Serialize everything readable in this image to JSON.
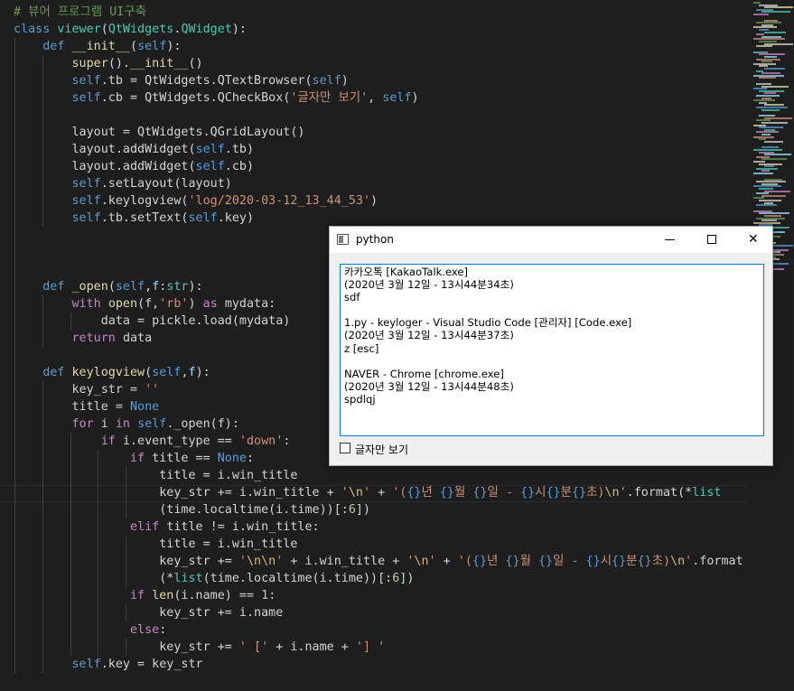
{
  "editor": {
    "lines": [
      [
        {
          "t": "# 뷰어 프로그램 UI구축",
          "c": "cmt"
        }
      ],
      [
        {
          "t": "class ",
          "c": "kw"
        },
        {
          "t": "viewer",
          "c": "cls"
        },
        {
          "t": "("
        },
        {
          "t": "QtWidgets",
          "c": "cls"
        },
        {
          "t": "."
        },
        {
          "t": "QWidget",
          "c": "cls"
        },
        {
          "t": "):"
        }
      ],
      [
        {
          "t": "    "
        },
        {
          "t": "def ",
          "c": "kw"
        },
        {
          "t": "__init__",
          "c": "fn"
        },
        {
          "t": "("
        },
        {
          "t": "self",
          "c": "self"
        },
        {
          "t": "):"
        }
      ],
      [
        {
          "t": "        "
        },
        {
          "t": "super",
          "c": "fn"
        },
        {
          "t": "()."
        },
        {
          "t": "__init__",
          "c": "fn"
        },
        {
          "t": "()"
        }
      ],
      [
        {
          "t": "        "
        },
        {
          "t": "self",
          "c": "self"
        },
        {
          "t": ".tb = QtWidgets.QTextBrowser("
        },
        {
          "t": "self",
          "c": "self"
        },
        {
          "t": ")"
        }
      ],
      [
        {
          "t": "        "
        },
        {
          "t": "self",
          "c": "self"
        },
        {
          "t": ".cb = QtWidgets.QCheckBox("
        },
        {
          "t": "'글자만 보기'",
          "c": "str"
        },
        {
          "t": ", "
        },
        {
          "t": "self",
          "c": "self"
        },
        {
          "t": ")"
        }
      ],
      [],
      [
        {
          "t": "        layout = QtWidgets.QGridLayout()"
        }
      ],
      [
        {
          "t": "        layout.addWidget("
        },
        {
          "t": "self",
          "c": "self"
        },
        {
          "t": ".tb)"
        }
      ],
      [
        {
          "t": "        layout.addWidget("
        },
        {
          "t": "self",
          "c": "self"
        },
        {
          "t": ".cb)"
        }
      ],
      [
        {
          "t": "        "
        },
        {
          "t": "self",
          "c": "self"
        },
        {
          "t": ".setLayout(layout)"
        }
      ],
      [
        {
          "t": "        "
        },
        {
          "t": "self",
          "c": "self"
        },
        {
          "t": ".keylogview("
        },
        {
          "t": "'log/2020-03-12_13_44_53'",
          "c": "str"
        },
        {
          "t": ")"
        }
      ],
      [
        {
          "t": "        "
        },
        {
          "t": "self",
          "c": "self"
        },
        {
          "t": ".tb.setText("
        },
        {
          "t": "self",
          "c": "self"
        },
        {
          "t": ".key)"
        }
      ],
      [],
      [],
      [],
      [
        {
          "t": "    "
        },
        {
          "t": "def ",
          "c": "kw"
        },
        {
          "t": "_open",
          "c": "fn"
        },
        {
          "t": "("
        },
        {
          "t": "self",
          "c": "self"
        },
        {
          "t": ","
        },
        {
          "t": "f",
          "c": "param"
        },
        {
          "t": ":"
        },
        {
          "t": "str",
          "c": "cls"
        },
        {
          "t": "):"
        }
      ],
      [
        {
          "t": "        "
        },
        {
          "t": "with ",
          "c": "ctl"
        },
        {
          "t": "open",
          "c": "fn"
        },
        {
          "t": "(f,"
        },
        {
          "t": "'rb'",
          "c": "str"
        },
        {
          "t": ") "
        },
        {
          "t": "as ",
          "c": "ctl"
        },
        {
          "t": "mydata:"
        }
      ],
      [
        {
          "t": "            data = pickle.load(mydata)"
        }
      ],
      [
        {
          "t": "        "
        },
        {
          "t": "return ",
          "c": "ctl"
        },
        {
          "t": "data"
        }
      ],
      [],
      [
        {
          "t": "    "
        },
        {
          "t": "def ",
          "c": "kw"
        },
        {
          "t": "keylogview",
          "c": "fn"
        },
        {
          "t": "("
        },
        {
          "t": "self",
          "c": "self"
        },
        {
          "t": ","
        },
        {
          "t": "f",
          "c": "param"
        },
        {
          "t": "):"
        }
      ],
      [
        {
          "t": "        key_str = "
        },
        {
          "t": "''",
          "c": "str"
        }
      ],
      [
        {
          "t": "        title = "
        },
        {
          "t": "None",
          "c": "kw"
        }
      ],
      [
        {
          "t": "        "
        },
        {
          "t": "for ",
          "c": "ctl"
        },
        {
          "t": "i "
        },
        {
          "t": "in ",
          "c": "ctl"
        },
        {
          "t": "self",
          "c": "self"
        },
        {
          "t": "._open(f):"
        }
      ],
      [
        {
          "t": "            "
        },
        {
          "t": "if ",
          "c": "ctl"
        },
        {
          "t": "i.event_type == "
        },
        {
          "t": "'down'",
          "c": "str"
        },
        {
          "t": ":"
        }
      ],
      [
        {
          "t": "                "
        },
        {
          "t": "if ",
          "c": "ctl"
        },
        {
          "t": "title == "
        },
        {
          "t": "None",
          "c": "kw"
        },
        {
          "t": ":"
        }
      ],
      [
        {
          "t": "                    title = i.win_title"
        }
      ],
      [
        {
          "t": "                    key_str += i.win_title + "
        },
        {
          "t": "'",
          "c": "str"
        },
        {
          "t": "\\n",
          "c": "esc"
        },
        {
          "t": "'",
          "c": "str"
        },
        {
          "t": " + "
        },
        {
          "t": "'(",
          "c": "str"
        },
        {
          "t": "{}",
          "c": "kw"
        },
        {
          "t": "년 ",
          "c": "str"
        },
        {
          "t": "{}",
          "c": "kw"
        },
        {
          "t": "월 ",
          "c": "str"
        },
        {
          "t": "{}",
          "c": "kw"
        },
        {
          "t": "일 - ",
          "c": "str"
        },
        {
          "t": "{}",
          "c": "kw"
        },
        {
          "t": "시",
          "c": "str"
        },
        {
          "t": "{}",
          "c": "kw"
        },
        {
          "t": "분",
          "c": "str"
        },
        {
          "t": "{}",
          "c": "kw"
        },
        {
          "t": "초)",
          "c": "str"
        },
        {
          "t": "\\n",
          "c": "esc"
        },
        {
          "t": "'",
          "c": "str"
        },
        {
          "t": ".format(*"
        },
        {
          "t": "list",
          "c": "cls"
        }
      ],
      [
        {
          "t": "                    (time.localtime(i.time))[:"
        },
        {
          "t": "6",
          "c": "num"
        },
        {
          "t": "])"
        }
      ],
      [
        {
          "t": "                "
        },
        {
          "t": "elif ",
          "c": "ctl"
        },
        {
          "t": "title != i.win_title:"
        }
      ],
      [
        {
          "t": "                    title = i.win_title"
        }
      ],
      [
        {
          "t": "                    key_str += "
        },
        {
          "t": "'",
          "c": "str"
        },
        {
          "t": "\\n\\n",
          "c": "esc"
        },
        {
          "t": "'",
          "c": "str"
        },
        {
          "t": " + i.win_title + "
        },
        {
          "t": "'",
          "c": "str"
        },
        {
          "t": "\\n",
          "c": "esc"
        },
        {
          "t": "'",
          "c": "str"
        },
        {
          "t": " + "
        },
        {
          "t": "'(",
          "c": "str"
        },
        {
          "t": "{}",
          "c": "kw"
        },
        {
          "t": "년 ",
          "c": "str"
        },
        {
          "t": "{}",
          "c": "kw"
        },
        {
          "t": "월 ",
          "c": "str"
        },
        {
          "t": "{}",
          "c": "kw"
        },
        {
          "t": "일 - ",
          "c": "str"
        },
        {
          "t": "{}",
          "c": "kw"
        },
        {
          "t": "시",
          "c": "str"
        },
        {
          "t": "{}",
          "c": "kw"
        },
        {
          "t": "분",
          "c": "str"
        },
        {
          "t": "{}",
          "c": "kw"
        },
        {
          "t": "초)",
          "c": "str"
        },
        {
          "t": "\\n",
          "c": "esc"
        },
        {
          "t": "'",
          "c": "str"
        },
        {
          "t": ".format"
        }
      ],
      [
        {
          "t": "                    (*"
        },
        {
          "t": "list",
          "c": "cls"
        },
        {
          "t": "(time.localtime(i.time))[:"
        },
        {
          "t": "6",
          "c": "num"
        },
        {
          "t": "])"
        }
      ],
      [
        {
          "t": "                "
        },
        {
          "t": "if ",
          "c": "ctl"
        },
        {
          "t": "len",
          "c": "fn"
        },
        {
          "t": "(i.name) == "
        },
        {
          "t": "1",
          "c": "num"
        },
        {
          "t": ":"
        }
      ],
      [
        {
          "t": "                    key_str += i.name"
        }
      ],
      [
        {
          "t": "                "
        },
        {
          "t": "else",
          "c": "ctl"
        },
        {
          "t": ":"
        }
      ],
      [
        {
          "t": "                    key_str += "
        },
        {
          "t": "' ['",
          "c": "str"
        },
        {
          "t": " + i.name + "
        },
        {
          "t": "'] '",
          "c": "str"
        }
      ],
      [
        {
          "t": "        "
        },
        {
          "t": "self",
          "c": "self"
        },
        {
          "t": ".key = key_str"
        }
      ]
    ]
  },
  "qt_window": {
    "title": "python",
    "minimize_glyph": "–",
    "maximize_glyph": "□",
    "close_glyph": "✕",
    "text_browser_lines": [
      "카카오톡 [KakaoTalk.exe]",
      "(2020년 3월 12일 - 13시44분34초)",
      "sdf",
      "",
      "1.py - keyloger - Visual Studio Code [관리자] [Code.exe]",
      "(2020년 3월 12일 - 13시44분37초)",
      "z [esc]",
      "",
      "NAVER - Chrome [chrome.exe]",
      "(2020년 3월 12일 - 13시44분48초)",
      "spdlqj"
    ],
    "checkbox_label": "글자만 보기",
    "checkbox_checked": false
  },
  "colors": {
    "editor_bg": "#1e1e1e",
    "keyword": "#569cd6",
    "control": "#c586c0",
    "function": "#dcdcaa",
    "class": "#4ec9b0",
    "string": "#ce9178",
    "comment": "#6a9955",
    "window_bg": "#f0f0f0",
    "focus_border": "#0078d7"
  }
}
